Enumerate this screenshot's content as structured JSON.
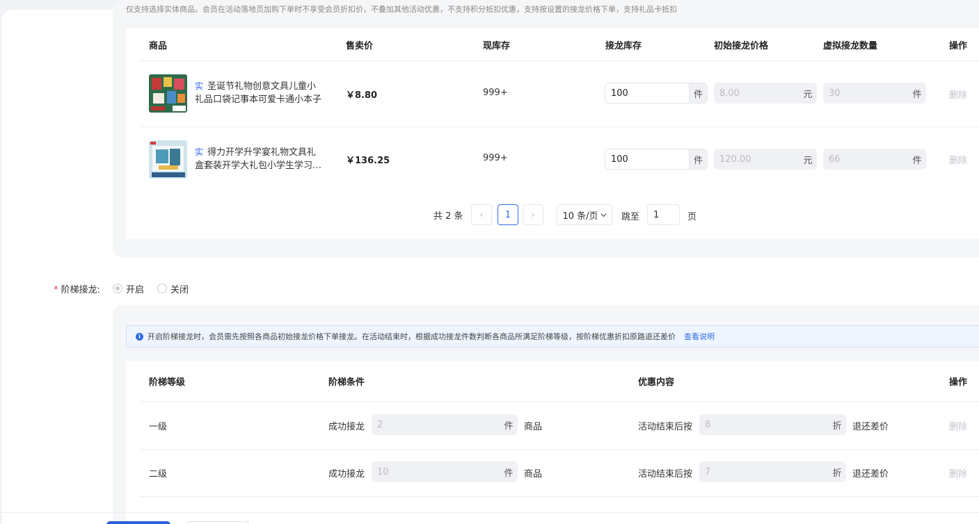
{
  "goods_section": {
    "cut_notice": "仅支持选择实体商品。会员在活动落地页加购下单时不享受会员折扣价，不叠加其他活动优惠，不支持积分抵扣优惠，支持按设置的接龙价格下单，支持礼品卡抵扣",
    "headers": {
      "product": "商品",
      "sale_price": "售卖价",
      "current_stock": "现库存",
      "relay_stock": "接龙库存",
      "init_price": "初始接龙价格",
      "virtual_qty": "虚拟接龙数量",
      "action": "操作"
    },
    "rows": [
      {
        "tag": "实",
        "name_line1": "圣诞节礼物创意文具儿童小",
        "name_line2": "礼品口袋记事本可爱卡通小本子",
        "price": "￥8.80",
        "stock": "999+",
        "relay_stock": "100",
        "relay_unit": "件",
        "init_price": "8.00",
        "init_unit": "元",
        "virtual_qty": "30",
        "virtual_unit": "件",
        "action": "删除"
      },
      {
        "tag": "实",
        "name_line1": "得力开学升学宴礼物文具礼",
        "name_line2": "盒套装开学大礼包小学生学习用品",
        "price": "￥136.25",
        "stock": "999+",
        "relay_stock": "100",
        "relay_unit": "件",
        "init_price": "120.00",
        "init_unit": "元",
        "virtual_qty": "66",
        "virtual_unit": "件",
        "action": "删除"
      }
    ],
    "pagination": {
      "total": "共 2 条",
      "prev": "‹",
      "current": "1",
      "next": "›",
      "page_size": "10 条/页",
      "jump_label": "跳至",
      "jump_value": "1",
      "page_suffix": "页"
    }
  },
  "tiered": {
    "required_mark": "*",
    "label": "阶梯接龙:",
    "options": {
      "on": "开启",
      "off": "关闭"
    },
    "selected": "on",
    "notice_text": "开启阶梯接龙时，会员需先按照各商品初始接龙价格下单接龙。在活动结束时，根据成功接龙件数判断各商品所满足阶梯等级，按阶梯优惠折扣原路退还差价",
    "notice_link": "查看说明",
    "headers": {
      "level": "阶梯等级",
      "condition": "阶梯条件",
      "discount": "优惠内容",
      "action": "操作"
    },
    "rows": [
      {
        "level": "一级",
        "cond_prefix": "成功接龙",
        "cond_value": "2",
        "cond_unit": "件",
        "cond_suffix": "商品",
        "disc_prefix": "活动结束后按",
        "disc_value": "8",
        "disc_unit": "折",
        "disc_suffix": "退还差价",
        "action": "删除"
      },
      {
        "level": "二级",
        "cond_prefix": "成功接龙",
        "cond_value": "10",
        "cond_unit": "件",
        "cond_suffix": "商品",
        "disc_prefix": "活动结束后按",
        "disc_value": "7",
        "disc_unit": "折",
        "disc_suffix": "退还差价",
        "action": "删除"
      }
    ]
  },
  "colors": {
    "accent": "#2d6be4",
    "required": "#e63c3c",
    "primary_button": "#2d5fd8"
  }
}
